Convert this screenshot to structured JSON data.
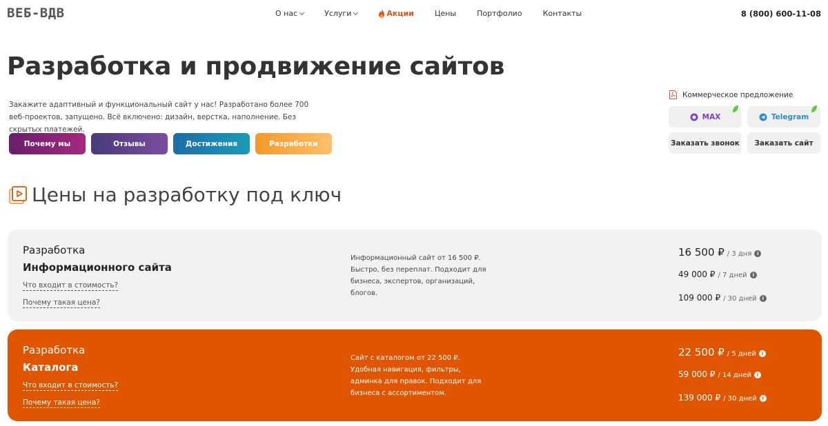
{
  "header": {
    "logo": "ВЕБ-ВДВ",
    "nav": [
      {
        "label": "О нас",
        "dropdown": true
      },
      {
        "label": "Услуги",
        "dropdown": true
      },
      {
        "label": "Акции",
        "dropdown": false
      },
      {
        "label": "Цены",
        "dropdown": false
      },
      {
        "label": "Портфолио",
        "dropdown": false
      },
      {
        "label": "Контакты",
        "dropdown": false
      }
    ],
    "phone": "8 (800) 600-11-08"
  },
  "hero": {
    "title": "Разработка и продвижение сайтов",
    "lead": "Закажите адаптивный и функциональный сайт у нас! Разработано более 700 веб-проектов, запущено. Всё включено: дизайн, верстка, наполнение. Без скрытых платежей.",
    "pills": [
      "Почему мы",
      "Отзывы",
      "Достижения",
      "Разработки"
    ]
  },
  "cta": {
    "offer": "Коммерческое предложение",
    "max": "MAX",
    "telegram": "Telegram",
    "call": "Заказать звонок",
    "order": "Заказать сайт"
  },
  "section": {
    "title": "Цены на разработку под ключ"
  },
  "cards": [
    {
      "pre": "Разработка",
      "name": "Информационного сайта",
      "link1": "Что входит в стоимость?",
      "link2": "Почему такая цена?",
      "desc": "Информационный сайт от 16 500 ₽. Быстро, без переплат. Подходит для бизнеса, экспертов, организаций, блогов.",
      "prices": [
        {
          "amount": "16 500 ₽",
          "term": "/ 3 дня"
        },
        {
          "amount": "49 000 ₽",
          "term": "/ 7 дней"
        },
        {
          "amount": "109 000 ₽",
          "term": "/ 30 дней"
        }
      ]
    },
    {
      "pre": "Разработка",
      "name": "Каталога",
      "link1": "Что входит в стоимость?",
      "link2": "Почему такая цена?",
      "desc": "Сайт с каталогом от 22 500 ₽. Удобная навигация, фильтры, админка для правок. Подходит для бизнеса с ассортиментом.",
      "prices": [
        {
          "amount": "22 500 ₽",
          "term": "/ 5 дней"
        },
        {
          "amount": "59 000 ₽",
          "term": "/ 14 дней"
        },
        {
          "amount": "139 000 ₽",
          "term": "/ 30 дней"
        }
      ]
    }
  ],
  "colors": {
    "accent": "#e05500",
    "promo": "#e8501a",
    "card_light": "#f2f2f2"
  }
}
